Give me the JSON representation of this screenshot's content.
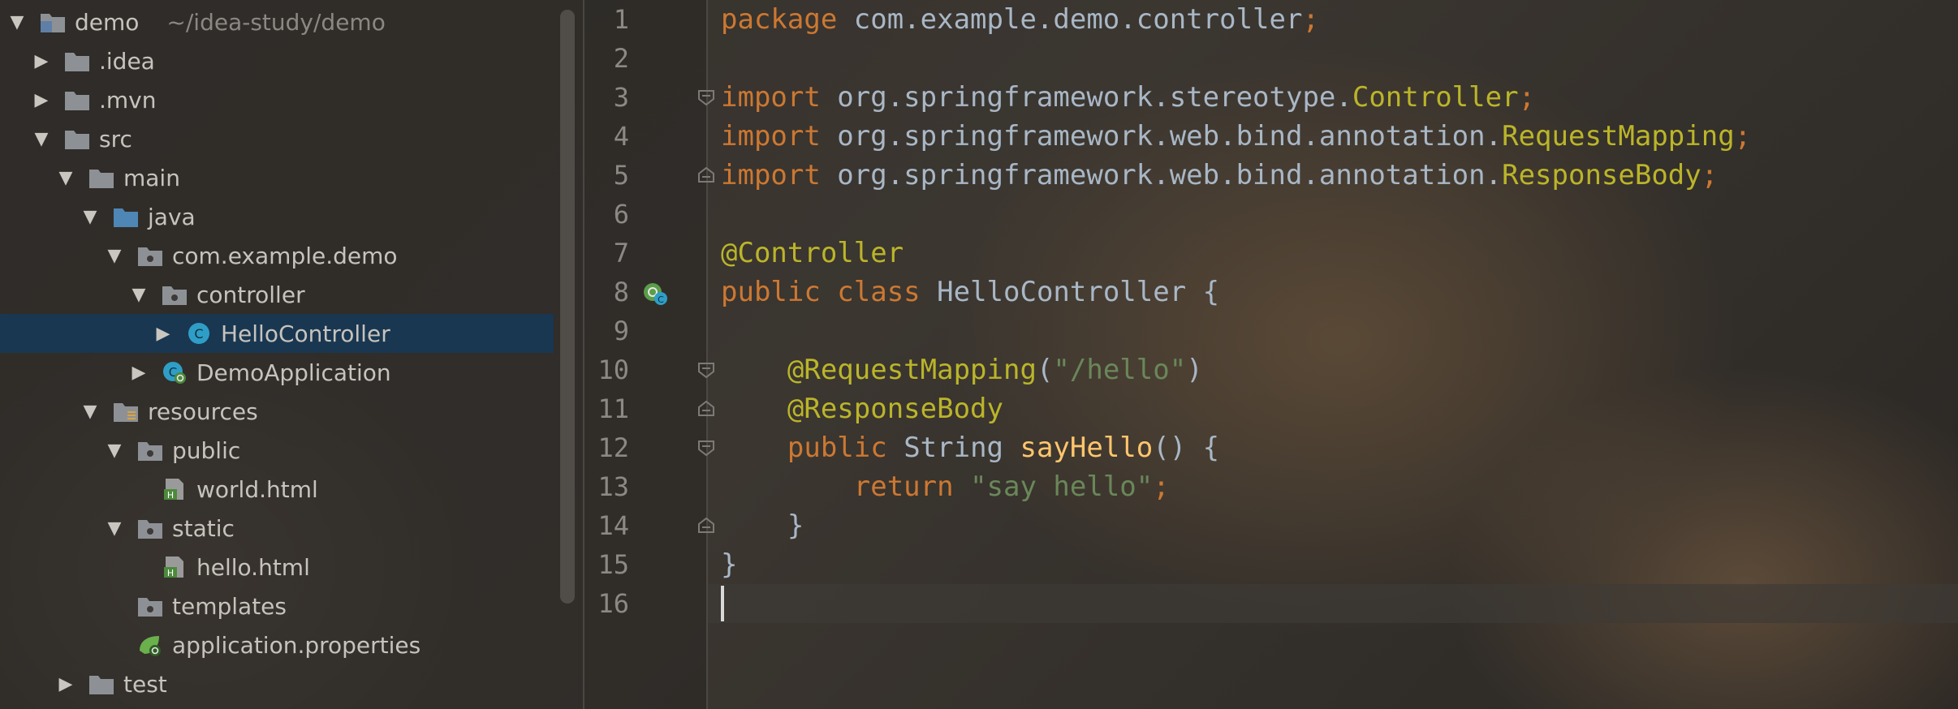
{
  "project_tree": {
    "items": [
      {
        "label": "demo",
        "note": "~/idea-study/demo",
        "depth": 0,
        "arrow": "down",
        "icon": "module-folder-icon"
      },
      {
        "label": ".idea",
        "depth": 1,
        "arrow": "right",
        "icon": "folder-icon"
      },
      {
        "label": ".mvn",
        "depth": 1,
        "arrow": "right",
        "icon": "folder-icon"
      },
      {
        "label": "src",
        "depth": 1,
        "arrow": "down",
        "icon": "folder-icon"
      },
      {
        "label": "main",
        "depth": 2,
        "arrow": "down",
        "icon": "folder-icon"
      },
      {
        "label": "java",
        "depth": 3,
        "arrow": "down",
        "icon": "source-folder-icon"
      },
      {
        "label": "com.example.demo",
        "depth": 4,
        "arrow": "down",
        "icon": "package-icon"
      },
      {
        "label": "controller",
        "depth": 5,
        "arrow": "down",
        "icon": "package-icon"
      },
      {
        "label": "HelloController",
        "depth": 6,
        "arrow": "right",
        "icon": "java-class-icon",
        "selected": true
      },
      {
        "label": "DemoApplication",
        "depth": 5,
        "arrow": "right",
        "icon": "spring-boot-class-icon"
      },
      {
        "label": "resources",
        "depth": 3,
        "arrow": "down",
        "icon": "resources-folder-icon"
      },
      {
        "label": "public",
        "depth": 4,
        "arrow": "down",
        "icon": "package-icon"
      },
      {
        "label": "world.html",
        "depth": 5,
        "arrow": "none",
        "icon": "html-file-icon"
      },
      {
        "label": "static",
        "depth": 4,
        "arrow": "down",
        "icon": "package-icon"
      },
      {
        "label": "hello.html",
        "depth": 5,
        "arrow": "none",
        "icon": "html-file-icon"
      },
      {
        "label": "templates",
        "depth": 4,
        "arrow": "none",
        "icon": "package-icon"
      },
      {
        "label": "application.properties",
        "depth": 4,
        "arrow": "none",
        "icon": "spring-properties-icon"
      },
      {
        "label": "test",
        "depth": 2,
        "arrow": "right",
        "icon": "folder-icon"
      }
    ]
  },
  "editor": {
    "line_numbers": [
      "1",
      "2",
      "3",
      "4",
      "5",
      "6",
      "7",
      "8",
      "9",
      "10",
      "11",
      "12",
      "13",
      "14",
      "15",
      "16"
    ],
    "lines": [
      [
        {
          "t": "package ",
          "c": "kw"
        },
        {
          "t": "com.example.demo.controller",
          "c": "plain"
        },
        {
          "t": ";",
          "c": "kw"
        }
      ],
      [],
      [
        {
          "t": "import ",
          "c": "kw"
        },
        {
          "t": "org.springframework.stereotype.",
          "c": "plain"
        },
        {
          "t": "Controller",
          "c": "cls"
        },
        {
          "t": ";",
          "c": "kw"
        }
      ],
      [
        {
          "t": "import ",
          "c": "kw"
        },
        {
          "t": "org.springframework.web.bind.annotation.",
          "c": "plain"
        },
        {
          "t": "RequestMapping",
          "c": "cls"
        },
        {
          "t": ";",
          "c": "kw"
        }
      ],
      [
        {
          "t": "import ",
          "c": "kw"
        },
        {
          "t": "org.springframework.web.bind.annotation.",
          "c": "plain"
        },
        {
          "t": "ResponseBody",
          "c": "cls"
        },
        {
          "t": ";",
          "c": "kw"
        }
      ],
      [],
      [
        {
          "t": "@Controller",
          "c": "ann"
        }
      ],
      [
        {
          "t": "public ",
          "c": "kw"
        },
        {
          "t": "class ",
          "c": "kw"
        },
        {
          "t": "HelloController {",
          "c": "plain"
        }
      ],
      [],
      [
        {
          "t": "    ",
          "c": "plain"
        },
        {
          "t": "@RequestMapping",
          "c": "ann"
        },
        {
          "t": "(",
          "c": "plain"
        },
        {
          "t": "\"/hello\"",
          "c": "str"
        },
        {
          "t": ")",
          "c": "plain"
        }
      ],
      [
        {
          "t": "    ",
          "c": "plain"
        },
        {
          "t": "@ResponseBody",
          "c": "ann"
        }
      ],
      [
        {
          "t": "    ",
          "c": "plain"
        },
        {
          "t": "public ",
          "c": "kw"
        },
        {
          "t": "String ",
          "c": "plain"
        },
        {
          "t": "sayHello",
          "c": "fn"
        },
        {
          "t": "() {",
          "c": "plain"
        }
      ],
      [
        {
          "t": "        ",
          "c": "plain"
        },
        {
          "t": "return ",
          "c": "kw"
        },
        {
          "t": "\"say hello\"",
          "c": "str"
        },
        {
          "t": ";",
          "c": "kw"
        }
      ],
      [
        {
          "t": "    }",
          "c": "plain"
        }
      ],
      [
        {
          "t": "}",
          "c": "plain"
        }
      ],
      []
    ],
    "gutter_marks": [
      {
        "line": 3,
        "icon": "fold-open-icon"
      },
      {
        "line": 5,
        "icon": "fold-close-icon"
      },
      {
        "line": 8,
        "icon": "spring-bean-gutter-icon"
      },
      {
        "line": 10,
        "icon": "fold-open-icon"
      },
      {
        "line": 11,
        "icon": "fold-close-icon"
      },
      {
        "line": 12,
        "icon": "fold-open-icon"
      },
      {
        "line": 14,
        "icon": "fold-close-icon"
      }
    ],
    "current_line": 16
  },
  "colors": {
    "keyword": "#cc7832",
    "annotation": "#bbb529",
    "string": "#6a8759",
    "method": "#ffc66d",
    "plain": "#a9b7c6",
    "selection": "#193751"
  }
}
